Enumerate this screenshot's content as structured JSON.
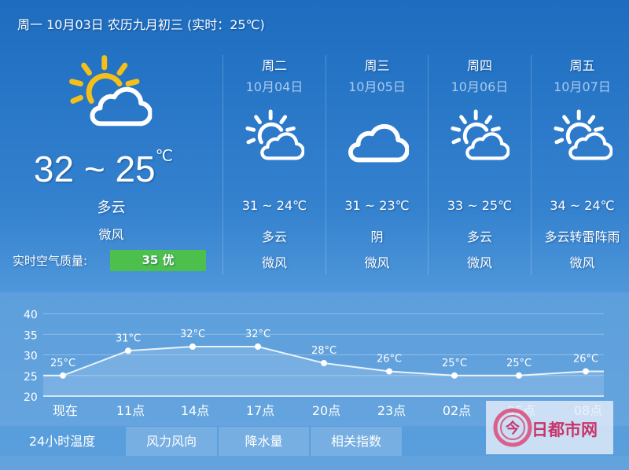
{
  "header": {
    "text": "周一 10月03日 农历九月初三 (实时：25℃)"
  },
  "today": {
    "icon": "partly-cloudy-icon",
    "temp": "32 ~ 25",
    "unit": "℃",
    "desc": "多云",
    "wind": "微风",
    "aq_label": "实时空气质量:",
    "aq_value": "35 优",
    "aq_color": "#4cbf4c"
  },
  "forecast": [
    {
      "weekday": "周二",
      "date": "10月04日",
      "icon": "partly-cloudy-icon",
      "temp": "31 ~ 24℃",
      "desc": "多云",
      "wind": "微风"
    },
    {
      "weekday": "周三",
      "date": "10月05日",
      "icon": "cloud-icon",
      "temp": "31 ~ 23℃",
      "desc": "阴",
      "wind": "微风"
    },
    {
      "weekday": "周四",
      "date": "10月06日",
      "icon": "partly-cloudy-icon",
      "temp": "33 ~ 25℃",
      "desc": "多云",
      "wind": "微风"
    },
    {
      "weekday": "周五",
      "date": "10月07日",
      "icon": "partly-cloudy-icon",
      "temp": "34 ~ 24℃",
      "desc": "多云转雷阵雨",
      "wind": "微风"
    }
  ],
  "chart_data": {
    "type": "line",
    "categories": [
      "现在",
      "11点",
      "14点",
      "17点",
      "20点",
      "23点",
      "02点",
      "05点",
      "08点"
    ],
    "values": [
      25,
      31,
      32,
      32,
      28,
      26,
      25,
      25,
      26
    ],
    "labels": [
      "25°C",
      "31°C",
      "32°C",
      "32°C",
      "28°C",
      "26°C",
      "25°C",
      "25°C",
      "26°C"
    ],
    "yticks": [
      40,
      35,
      30,
      25,
      20
    ],
    "ylim": [
      20,
      40
    ],
    "grid": true
  },
  "tabs": [
    {
      "label": "24小时温度",
      "active": true
    },
    {
      "label": "风力风向"
    },
    {
      "label": "降水量"
    },
    {
      "label": "相关指数"
    }
  ],
  "watermark": {
    "text": "今日都市网"
  }
}
